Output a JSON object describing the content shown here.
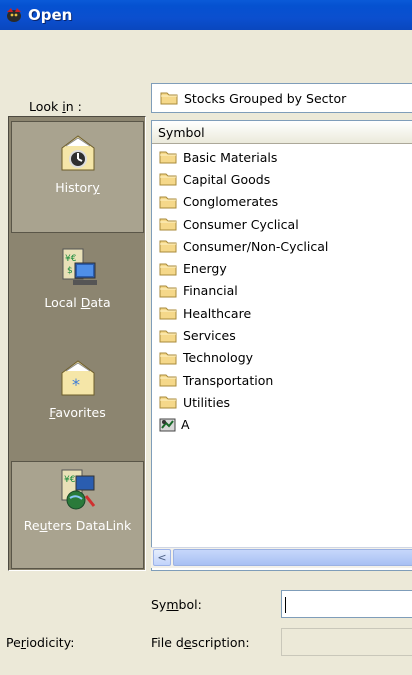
{
  "window": {
    "title": "Open"
  },
  "lookin": {
    "label_pre": "Look ",
    "label_key": "i",
    "label_post": "n :",
    "value": "Stocks Grouped by Sector"
  },
  "places": [
    {
      "pre": "Histor",
      "key": "y",
      "post": ""
    },
    {
      "pre": "Local ",
      "key": "D",
      "post": "ata"
    },
    {
      "pre": "",
      "key": "F",
      "post": "avorites"
    },
    {
      "pre": "Re",
      "key": "u",
      "post": "ters DataLink"
    }
  ],
  "list": {
    "column_header": "Symbol",
    "folders": [
      "Basic Materials",
      "Capital Goods",
      "Conglomerates",
      "Consumer Cyclical",
      "Consumer/Non-Cyclical",
      "Energy",
      "Financial",
      "Healthcare",
      "Services",
      "Technology",
      "Transportation",
      "Utilities"
    ],
    "symbol_item": "A"
  },
  "scroll": {
    "left_arrow": "<"
  },
  "symbol": {
    "pre": "Sy",
    "key": "m",
    "post": "bol:",
    "value": ""
  },
  "description": {
    "pre": "File d",
    "key": "e",
    "post": "scription:",
    "value": ""
  },
  "periodicity": {
    "pre": "Pe",
    "key": "r",
    "post": "iodicity:"
  },
  "colors": {
    "titlebar": "#0b4fcf",
    "places_bg": "#8c8570",
    "dialog_bg": "#ece9d8",
    "folder": "#f5d88a"
  }
}
